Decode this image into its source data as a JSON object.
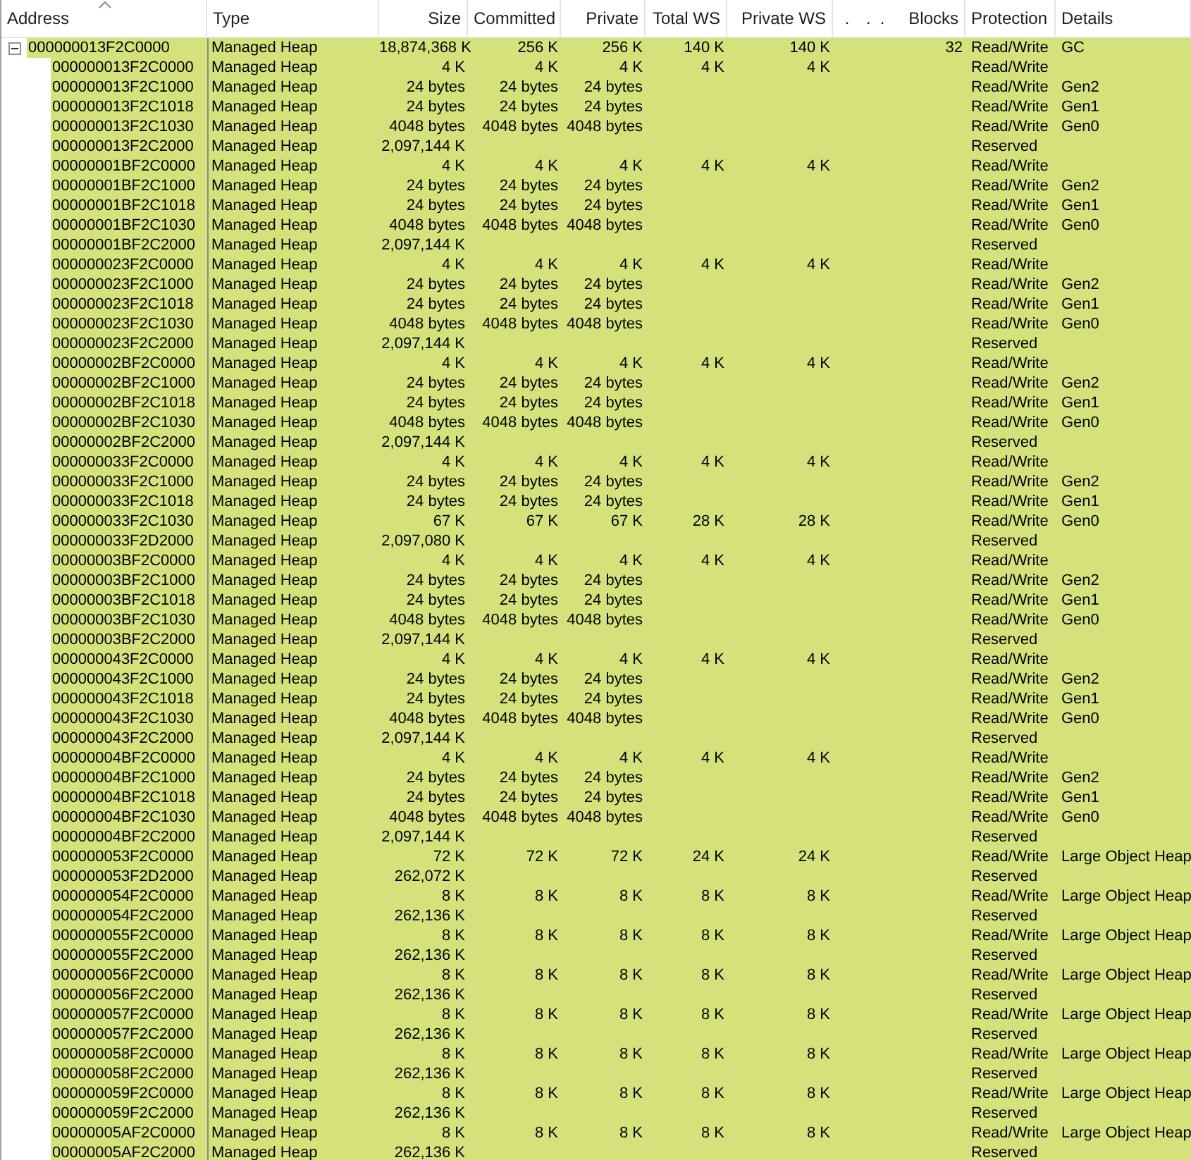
{
  "columns": [
    {
      "label": "Address",
      "sorted": true
    },
    {
      "label": "Type",
      "sorted": false
    },
    {
      "label": "Size",
      "sorted": false
    },
    {
      "label": "Committed",
      "sorted": false
    },
    {
      "label": "Private",
      "sorted": false
    },
    {
      "label": "Total WS",
      "sorted": false
    },
    {
      "label": "Private WS",
      "sorted": false
    },
    {
      "label": ".",
      "sorted": false
    },
    {
      "label": ".",
      "sorted": false
    },
    {
      "label": ".",
      "sorted": false
    },
    {
      "label": "Blocks",
      "sorted": false
    },
    {
      "label": "Protection",
      "sorted": false
    },
    {
      "label": "Details",
      "sorted": false
    }
  ],
  "regions": [
    {
      "address": "000000013F2C0000",
      "type": "Managed Heap",
      "size": "18,874,368 K",
      "committed": "256 K",
      "private": "256 K",
      "total_ws": "140 K",
      "private_ws": "140 K",
      "blocks": "32",
      "protection": "Read/Write",
      "details": "GC",
      "selected": true,
      "expanded": true,
      "children": [
        {
          "address": "000000013F2C0000",
          "type": "Managed Heap",
          "size": "4 K",
          "committed": "4 K",
          "private": "4 K",
          "total_ws": "4 K",
          "private_ws": "4 K",
          "protection": "Read/Write",
          "selected": true
        },
        {
          "address": "000000013F2C1000",
          "type": "Managed Heap",
          "size": "24 bytes",
          "committed": "24 bytes",
          "private": "24 bytes",
          "protection": "Read/Write",
          "details": "Gen2",
          "selected": true
        },
        {
          "address": "000000013F2C1018",
          "type": "Managed Heap",
          "size": "24 bytes",
          "committed": "24 bytes",
          "private": "24 bytes",
          "protection": "Read/Write",
          "details": "Gen1",
          "selected": true
        },
        {
          "address": "000000013F2C1030",
          "type": "Managed Heap",
          "size": "4048 bytes",
          "committed": "4048 bytes",
          "private": "4048 bytes",
          "protection": "Read/Write",
          "details": "Gen0",
          "selected": true
        },
        {
          "address": "000000013F2C2000",
          "type": "Managed Heap",
          "size": "2,097,144 K",
          "protection": "Reserved",
          "selected": true
        },
        {
          "address": "00000001BF2C0000",
          "type": "Managed Heap",
          "size": "4 K",
          "committed": "4 K",
          "private": "4 K",
          "total_ws": "4 K",
          "private_ws": "4 K",
          "protection": "Read/Write",
          "selected": true
        },
        {
          "address": "00000001BF2C1000",
          "type": "Managed Heap",
          "size": "24 bytes",
          "committed": "24 bytes",
          "private": "24 bytes",
          "protection": "Read/Write",
          "details": "Gen2",
          "selected": true
        },
        {
          "address": "00000001BF2C1018",
          "type": "Managed Heap",
          "size": "24 bytes",
          "committed": "24 bytes",
          "private": "24 bytes",
          "protection": "Read/Write",
          "details": "Gen1",
          "selected": true
        },
        {
          "address": "00000001BF2C1030",
          "type": "Managed Heap",
          "size": "4048 bytes",
          "committed": "4048 bytes",
          "private": "4048 bytes",
          "protection": "Read/Write",
          "details": "Gen0",
          "selected": true
        },
        {
          "address": "00000001BF2C2000",
          "type": "Managed Heap",
          "size": "2,097,144 K",
          "protection": "Reserved",
          "selected": true
        },
        {
          "address": "000000023F2C0000",
          "type": "Managed Heap",
          "size": "4 K",
          "committed": "4 K",
          "private": "4 K",
          "total_ws": "4 K",
          "private_ws": "4 K",
          "protection": "Read/Write",
          "selected": true
        },
        {
          "address": "000000023F2C1000",
          "type": "Managed Heap",
          "size": "24 bytes",
          "committed": "24 bytes",
          "private": "24 bytes",
          "protection": "Read/Write",
          "details": "Gen2",
          "selected": true
        },
        {
          "address": "000000023F2C1018",
          "type": "Managed Heap",
          "size": "24 bytes",
          "committed": "24 bytes",
          "private": "24 bytes",
          "protection": "Read/Write",
          "details": "Gen1",
          "selected": true
        },
        {
          "address": "000000023F2C1030",
          "type": "Managed Heap",
          "size": "4048 bytes",
          "committed": "4048 bytes",
          "private": "4048 bytes",
          "protection": "Read/Write",
          "details": "Gen0",
          "selected": true
        },
        {
          "address": "000000023F2C2000",
          "type": "Managed Heap",
          "size": "2,097,144 K",
          "protection": "Reserved",
          "selected": true
        },
        {
          "address": "00000002BF2C0000",
          "type": "Managed Heap",
          "size": "4 K",
          "committed": "4 K",
          "private": "4 K",
          "total_ws": "4 K",
          "private_ws": "4 K",
          "protection": "Read/Write",
          "selected": true
        },
        {
          "address": "00000002BF2C1000",
          "type": "Managed Heap",
          "size": "24 bytes",
          "committed": "24 bytes",
          "private": "24 bytes",
          "protection": "Read/Write",
          "details": "Gen2",
          "selected": true
        },
        {
          "address": "00000002BF2C1018",
          "type": "Managed Heap",
          "size": "24 bytes",
          "committed": "24 bytes",
          "private": "24 bytes",
          "protection": "Read/Write",
          "details": "Gen1",
          "selected": true
        },
        {
          "address": "00000002BF2C1030",
          "type": "Managed Heap",
          "size": "4048 bytes",
          "committed": "4048 bytes",
          "private": "4048 bytes",
          "protection": "Read/Write",
          "details": "Gen0",
          "selected": true
        },
        {
          "address": "00000002BF2C2000",
          "type": "Managed Heap",
          "size": "2,097,144 K",
          "protection": "Reserved",
          "selected": true
        },
        {
          "address": "000000033F2C0000",
          "type": "Managed Heap",
          "size": "4 K",
          "committed": "4 K",
          "private": "4 K",
          "total_ws": "4 K",
          "private_ws": "4 K",
          "protection": "Read/Write",
          "selected": true
        },
        {
          "address": "000000033F2C1000",
          "type": "Managed Heap",
          "size": "24 bytes",
          "committed": "24 bytes",
          "private": "24 bytes",
          "protection": "Read/Write",
          "details": "Gen2",
          "selected": true
        },
        {
          "address": "000000033F2C1018",
          "type": "Managed Heap",
          "size": "24 bytes",
          "committed": "24 bytes",
          "private": "24 bytes",
          "protection": "Read/Write",
          "details": "Gen1",
          "selected": true
        },
        {
          "address": "000000033F2C1030",
          "type": "Managed Heap",
          "size": "67 K",
          "committed": "67 K",
          "private": "67 K",
          "total_ws": "28 K",
          "private_ws": "28 K",
          "protection": "Read/Write",
          "details": "Gen0",
          "selected": true
        },
        {
          "address": "000000033F2D2000",
          "type": "Managed Heap",
          "size": "2,097,080 K",
          "protection": "Reserved",
          "selected": true
        },
        {
          "address": "00000003BF2C0000",
          "type": "Managed Heap",
          "size": "4 K",
          "committed": "4 K",
          "private": "4 K",
          "total_ws": "4 K",
          "private_ws": "4 K",
          "protection": "Read/Write",
          "selected": true
        },
        {
          "address": "00000003BF2C1000",
          "type": "Managed Heap",
          "size": "24 bytes",
          "committed": "24 bytes",
          "private": "24 bytes",
          "protection": "Read/Write",
          "details": "Gen2",
          "selected": true
        },
        {
          "address": "00000003BF2C1018",
          "type": "Managed Heap",
          "size": "24 bytes",
          "committed": "24 bytes",
          "private": "24 bytes",
          "protection": "Read/Write",
          "details": "Gen1",
          "selected": true
        },
        {
          "address": "00000003BF2C1030",
          "type": "Managed Heap",
          "size": "4048 bytes",
          "committed": "4048 bytes",
          "private": "4048 bytes",
          "protection": "Read/Write",
          "details": "Gen0",
          "selected": true
        },
        {
          "address": "00000003BF2C2000",
          "type": "Managed Heap",
          "size": "2,097,144 K",
          "protection": "Reserved",
          "selected": true
        },
        {
          "address": "000000043F2C0000",
          "type": "Managed Heap",
          "size": "4 K",
          "committed": "4 K",
          "private": "4 K",
          "total_ws": "4 K",
          "private_ws": "4 K",
          "protection": "Read/Write",
          "selected": true
        },
        {
          "address": "000000043F2C1000",
          "type": "Managed Heap",
          "size": "24 bytes",
          "committed": "24 bytes",
          "private": "24 bytes",
          "protection": "Read/Write",
          "details": "Gen2",
          "selected": true
        },
        {
          "address": "000000043F2C1018",
          "type": "Managed Heap",
          "size": "24 bytes",
          "committed": "24 bytes",
          "private": "24 bytes",
          "protection": "Read/Write",
          "details": "Gen1",
          "selected": true
        },
        {
          "address": "000000043F2C1030",
          "type": "Managed Heap",
          "size": "4048 bytes",
          "committed": "4048 bytes",
          "private": "4048 bytes",
          "protection": "Read/Write",
          "details": "Gen0",
          "selected": true
        },
        {
          "address": "000000043F2C2000",
          "type": "Managed Heap",
          "size": "2,097,144 K",
          "protection": "Reserved",
          "selected": true
        },
        {
          "address": "00000004BF2C0000",
          "type": "Managed Heap",
          "size": "4 K",
          "committed": "4 K",
          "private": "4 K",
          "total_ws": "4 K",
          "private_ws": "4 K",
          "protection": "Read/Write",
          "selected": true
        },
        {
          "address": "00000004BF2C1000",
          "type": "Managed Heap",
          "size": "24 bytes",
          "committed": "24 bytes",
          "private": "24 bytes",
          "protection": "Read/Write",
          "details": "Gen2",
          "selected": true
        },
        {
          "address": "00000004BF2C1018",
          "type": "Managed Heap",
          "size": "24 bytes",
          "committed": "24 bytes",
          "private": "24 bytes",
          "protection": "Read/Write",
          "details": "Gen1",
          "selected": true
        },
        {
          "address": "00000004BF2C1030",
          "type": "Managed Heap",
          "size": "4048 bytes",
          "committed": "4048 bytes",
          "private": "4048 bytes",
          "protection": "Read/Write",
          "details": "Gen0",
          "selected": true
        },
        {
          "address": "00000004BF2C2000",
          "type": "Managed Heap",
          "size": "2,097,144 K",
          "protection": "Reserved",
          "selected": true
        },
        {
          "address": "000000053F2C0000",
          "type": "Managed Heap",
          "size": "72 K",
          "committed": "72 K",
          "private": "72 K",
          "total_ws": "24 K",
          "private_ws": "24 K",
          "protection": "Read/Write",
          "details": "Large Object Heap",
          "selected": true
        },
        {
          "address": "000000053F2D2000",
          "type": "Managed Heap",
          "size": "262,072 K",
          "protection": "Reserved",
          "selected": true
        },
        {
          "address": "000000054F2C0000",
          "type": "Managed Heap",
          "size": "8 K",
          "committed": "8 K",
          "private": "8 K",
          "total_ws": "8 K",
          "private_ws": "8 K",
          "protection": "Read/Write",
          "details": "Large Object Heap",
          "selected": true
        },
        {
          "address": "000000054F2C2000",
          "type": "Managed Heap",
          "size": "262,136 K",
          "protection": "Reserved",
          "selected": true
        },
        {
          "address": "000000055F2C0000",
          "type": "Managed Heap",
          "size": "8 K",
          "committed": "8 K",
          "private": "8 K",
          "total_ws": "8 K",
          "private_ws": "8 K",
          "protection": "Read/Write",
          "details": "Large Object Heap",
          "selected": true
        },
        {
          "address": "000000055F2C2000",
          "type": "Managed Heap",
          "size": "262,136 K",
          "protection": "Reserved",
          "selected": true
        },
        {
          "address": "000000056F2C0000",
          "type": "Managed Heap",
          "size": "8 K",
          "committed": "8 K",
          "private": "8 K",
          "total_ws": "8 K",
          "private_ws": "8 K",
          "protection": "Read/Write",
          "details": "Large Object Heap",
          "selected": true
        },
        {
          "address": "000000056F2C2000",
          "type": "Managed Heap",
          "size": "262,136 K",
          "protection": "Reserved",
          "selected": true
        },
        {
          "address": "000000057F2C0000",
          "type": "Managed Heap",
          "size": "8 K",
          "committed": "8 K",
          "private": "8 K",
          "total_ws": "8 K",
          "private_ws": "8 K",
          "protection": "Read/Write",
          "details": "Large Object Heap",
          "selected": true
        },
        {
          "address": "000000057F2C2000",
          "type": "Managed Heap",
          "size": "262,136 K",
          "protection": "Reserved",
          "selected": true
        },
        {
          "address": "000000058F2C0000",
          "type": "Managed Heap",
          "size": "8 K",
          "committed": "8 K",
          "private": "8 K",
          "total_ws": "8 K",
          "private_ws": "8 K",
          "protection": "Read/Write",
          "details": "Large Object Heap",
          "selected": true
        },
        {
          "address": "000000058F2C2000",
          "type": "Managed Heap",
          "size": "262,136 K",
          "protection": "Reserved",
          "selected": true
        },
        {
          "address": "000000059F2C0000",
          "type": "Managed Heap",
          "size": "8 K",
          "committed": "8 K",
          "private": "8 K",
          "total_ws": "8 K",
          "private_ws": "8 K",
          "protection": "Read/Write",
          "details": "Large Object Heap",
          "selected": true
        },
        {
          "address": "000000059F2C2000",
          "type": "Managed Heap",
          "size": "262,136 K",
          "protection": "Reserved",
          "selected": true
        },
        {
          "address": "00000005AF2C0000",
          "type": "Managed Heap",
          "size": "8 K",
          "committed": "8 K",
          "private": "8 K",
          "total_ws": "8 K",
          "private_ws": "8 K",
          "protection": "Read/Write",
          "details": "Large Object Heap",
          "selected": true
        },
        {
          "address": "00000005AF2C2000",
          "type": "Managed Heap",
          "size": "262,136 K",
          "protection": "Reserved",
          "selected": true
        }
      ]
    }
  ]
}
